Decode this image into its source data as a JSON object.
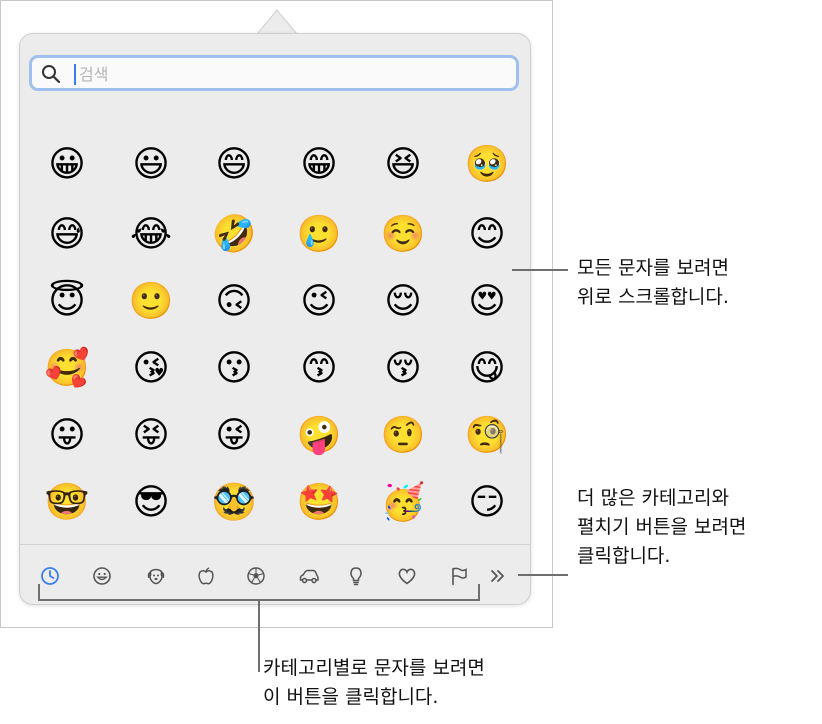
{
  "search": {
    "placeholder": "검색",
    "value": ""
  },
  "emoji_rows": [
    [
      "😀",
      "😃",
      "😄",
      "😁",
      "😆",
      "🥹"
    ],
    [
      "😅",
      "😂",
      "🤣",
      "🥲",
      "☺️",
      "😊"
    ],
    [
      "😇",
      "🙂",
      "🙃",
      "😉",
      "😌",
      "😍"
    ],
    [
      "🥰",
      "😘",
      "😗",
      "😙",
      "😚",
      "😋"
    ],
    [
      "😛",
      "😝",
      "😜",
      "🤪",
      "🤨",
      "🧐"
    ],
    [
      "🤓",
      "😎",
      "🥸",
      "🤩",
      "🥳",
      "😏"
    ]
  ],
  "categories": [
    {
      "id": "recent",
      "icon": "clock-icon",
      "selected": true
    },
    {
      "id": "smileys",
      "icon": "smiley-icon"
    },
    {
      "id": "animals",
      "icon": "dog-icon"
    },
    {
      "id": "food",
      "icon": "apple-icon"
    },
    {
      "id": "activity",
      "icon": "soccer-ball-icon"
    },
    {
      "id": "travel",
      "icon": "car-icon"
    },
    {
      "id": "objects",
      "icon": "lightbulb-icon"
    },
    {
      "id": "symbols",
      "icon": "heart-icon"
    },
    {
      "id": "flags",
      "icon": "flag-icon"
    }
  ],
  "expand_icon": "double-chevron-right-icon",
  "accent_color": "#3a7ff0",
  "callouts": {
    "scroll": [
      "모든 문자를 보려면",
      "위로 스크롤합니다."
    ],
    "more": [
      "더 많은 카테고리와",
      "펼치기 버튼을 보려면",
      "클릭합니다."
    ],
    "category": [
      "카테고리별로 문자를 보려면",
      "이 버튼을 클릭합니다."
    ]
  }
}
